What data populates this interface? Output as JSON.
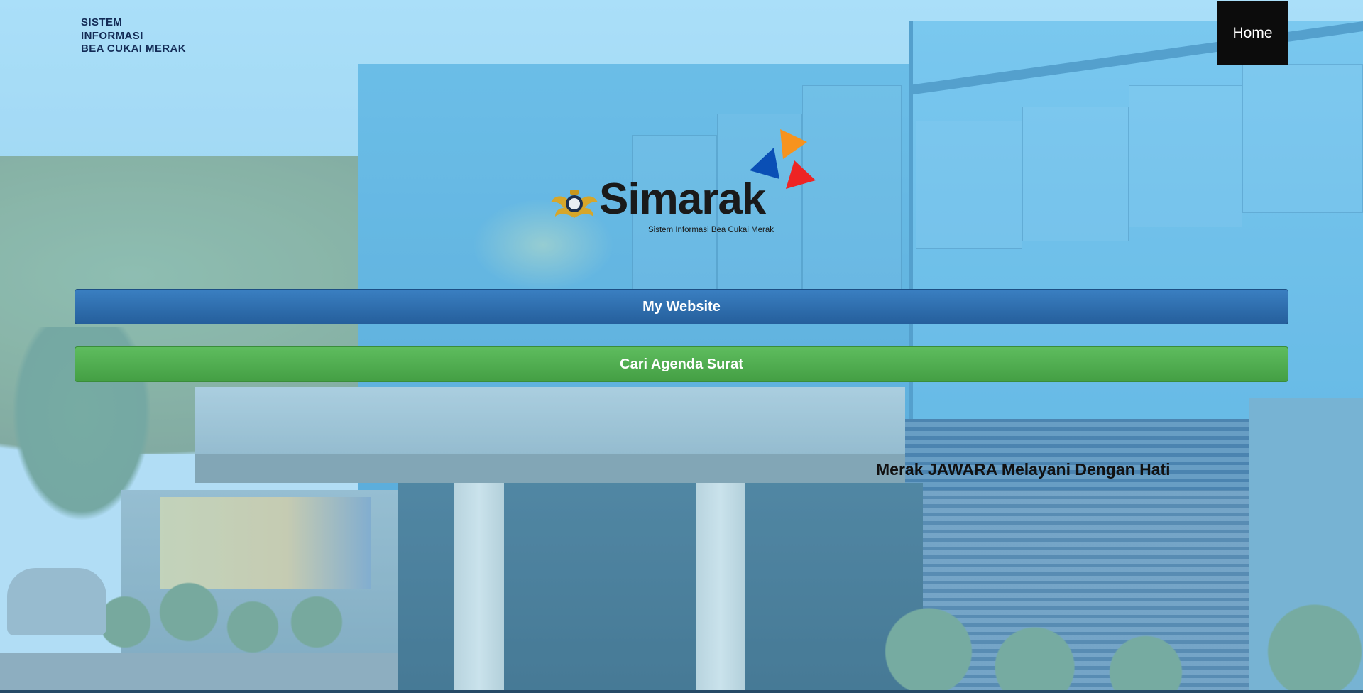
{
  "header": {
    "brand_lines": [
      "SISTEM",
      "INFORMASI",
      "BEA CUKAI MERAK"
    ],
    "nav": {
      "home_label": "Home"
    }
  },
  "logo": {
    "wordmark": "Simarak",
    "tagline": "Sistem Informasi Bea Cukai Merak",
    "emblem_icon": "bea-cukai-emblem-icon",
    "accent_colors": [
      "#f7931e",
      "#0a4fb5",
      "#ee2424"
    ]
  },
  "actions": {
    "website_label": "My Website",
    "agenda_label": "Cari Agenda Surat"
  },
  "slogan": "Merak JAWARA Melayani Dengan Hati",
  "colors": {
    "website_button": "#2f6fad",
    "agenda_button": "#4cae4c",
    "home_button": "#0c0c0c",
    "brand_text": "#132b56"
  }
}
